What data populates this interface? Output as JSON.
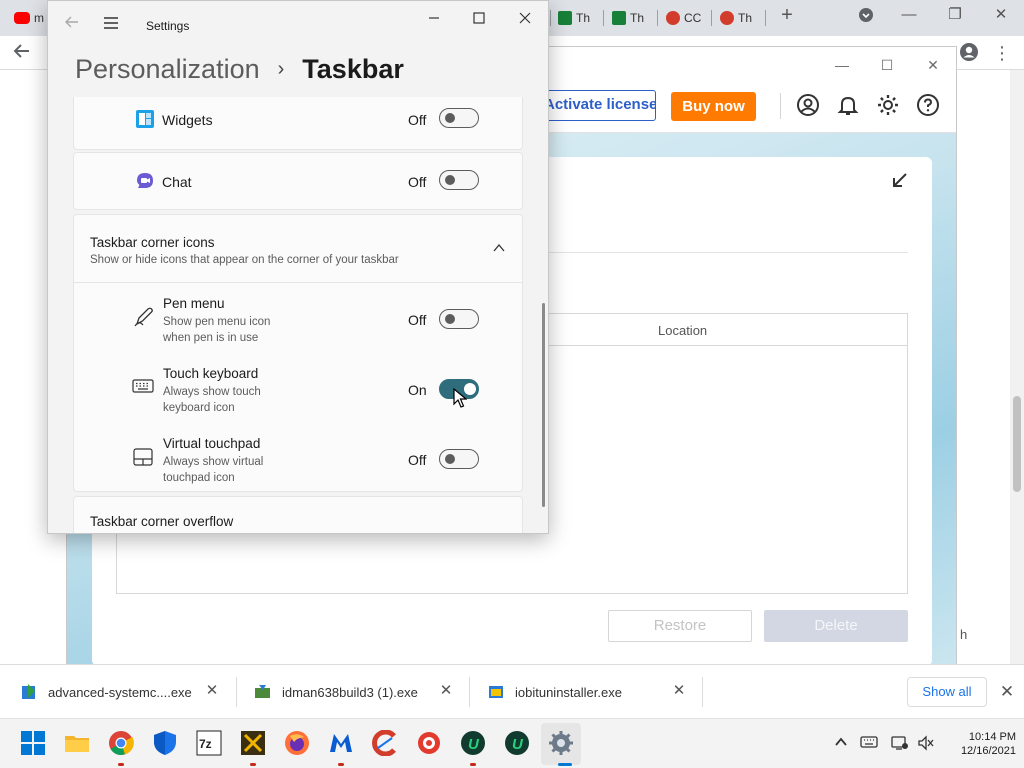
{
  "browser": {
    "tabs": [
      {
        "label": "m",
        "icon": "youtube-icon",
        "color": "#ff0000"
      },
      {
        "label": "Th",
        "icon": "sheets-icon",
        "color": "#188038"
      },
      {
        "label": "Th",
        "icon": "sheets-icon",
        "color": "#188038"
      },
      {
        "label": "CC",
        "icon": "ccleaner-icon",
        "color": "#d23c2b"
      },
      {
        "label": "Th",
        "icon": "ccleaner-icon",
        "color": "#d23c2b"
      }
    ],
    "new_tab": "+",
    "window_controls": [
      "—",
      "❐",
      "✕"
    ]
  },
  "app": {
    "activate_label": "Activate license",
    "buy_now_label": "Buy now",
    "brand_color": "#ff7a00",
    "column_location": "Location",
    "restore_label": "Restore",
    "delete_label": "Delete",
    "side_text": "h"
  },
  "settings": {
    "window_title": "Settings",
    "breadcrumb_parent": "Personalization",
    "breadcrumb_separator": "›",
    "breadcrumb_current": "Taskbar",
    "items_top": [
      {
        "label": "Widgets",
        "state": "Off",
        "icon": "widgets-icon"
      },
      {
        "label": "Chat",
        "state": "Off",
        "icon": "chat-icon"
      }
    ],
    "corner_icons": {
      "title": "Taskbar corner icons",
      "subtitle": "Show or hide icons that appear on the corner of your taskbar",
      "items": [
        {
          "label": "Pen menu",
          "sub1": "Show pen menu icon",
          "sub2": "when pen is in use",
          "state": "Off",
          "icon": "pen-icon"
        },
        {
          "label": "Touch keyboard",
          "sub1": "Always show touch",
          "sub2": "keyboard icon",
          "state": "On",
          "icon": "keyboard-icon"
        },
        {
          "label": "Virtual touchpad",
          "sub1": "Always show virtual",
          "sub2": "touchpad icon",
          "state": "Off",
          "icon": "touchpad-icon"
        }
      ]
    },
    "overflow": {
      "title": "Taskbar corner overflow"
    },
    "accent_color": "#2f6d7c"
  },
  "downloads": {
    "items": [
      {
        "name": "advanced-systemc....exe"
      },
      {
        "name": "idman638build3 (1).exe"
      },
      {
        "name": "iobituninstaller.exe"
      }
    ],
    "show_all_label": "Show all"
  },
  "taskbar": {
    "time": "10:14 PM",
    "date": "12/16/2021"
  }
}
